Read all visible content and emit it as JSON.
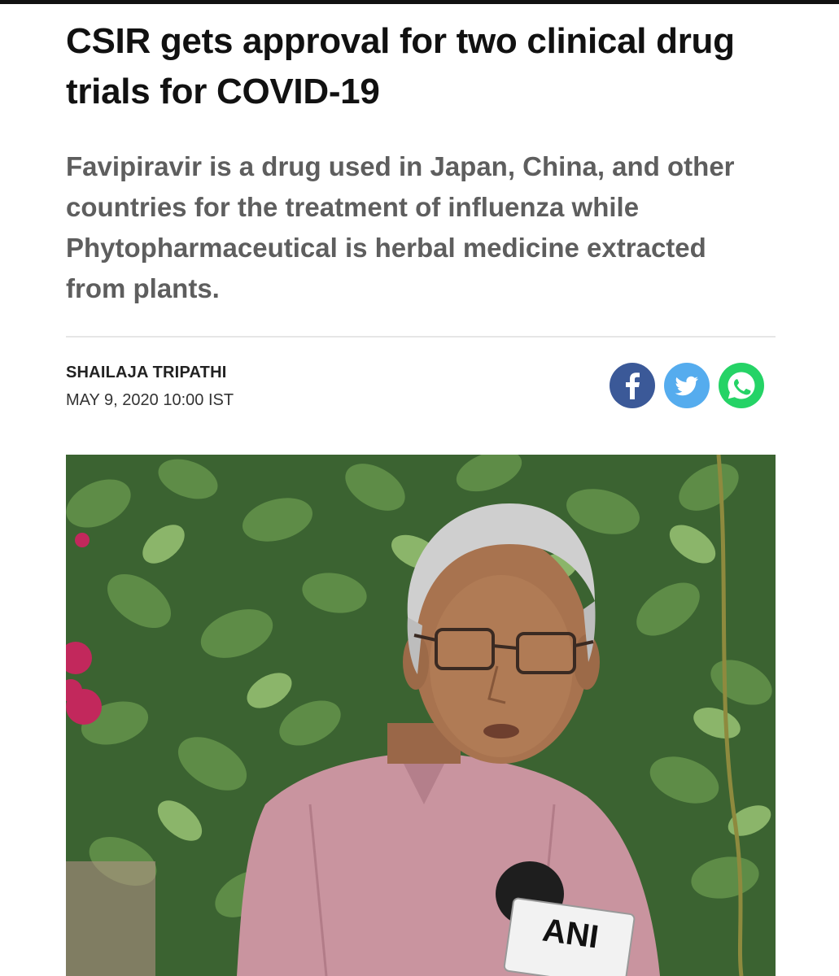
{
  "article": {
    "headline": "CSIR gets approval for two clinical drug trials for COVID-19",
    "summary": "Favipiravir is a drug used in Japan, China, and other countries for the treatment of influenza while Phytopharmaceutical is herbal medicine extracted from plants.",
    "author": "SHAILAJA TRIPATHI",
    "dateline": "MAY 9, 2020 10:00 IST"
  },
  "share": {
    "buttons": [
      {
        "icon": "facebook-icon",
        "color": "#3b5998"
      },
      {
        "icon": "twitter-icon",
        "color": "#55acee"
      },
      {
        "icon": "whatsapp-icon",
        "color": "#25d366"
      }
    ]
  },
  "photo": {
    "mic_brand": "ANI"
  }
}
